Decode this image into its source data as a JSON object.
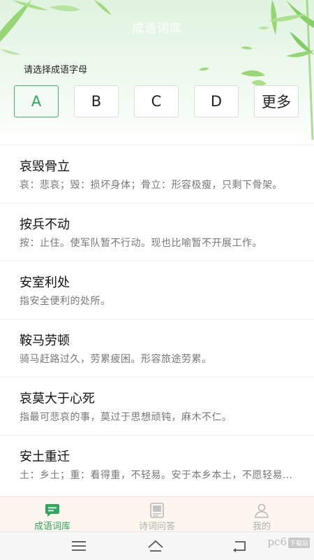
{
  "header": {
    "title": "成语词库",
    "prompt": "请选择成语字母"
  },
  "letters": [
    {
      "label": "A",
      "active": true
    },
    {
      "label": "B",
      "active": false
    },
    {
      "label": "C",
      "active": false
    },
    {
      "label": "D",
      "active": false
    },
    {
      "label": "更多",
      "active": false
    }
  ],
  "idioms": [
    {
      "name": "哀毁骨立",
      "desc": "哀：悲哀；毁：损坏身体；骨立：形容极瘦，只剩下骨架。"
    },
    {
      "name": "按兵不动",
      "desc": "按：止住。使军队暂不行动。现也比喻暂不开展工作。"
    },
    {
      "name": "安室利处",
      "desc": "指安全便利的处所。"
    },
    {
      "name": "鞍马劳顿",
      "desc": "骑马赶路过久，劳累疲困。形容旅途劳累。"
    },
    {
      "name": "哀莫大于心死",
      "desc": "指最可悲哀的事，莫过于思想顽钝，麻木不仁。"
    },
    {
      "name": "安土重迁",
      "desc": "土：乡土；重：看得重，不轻易。安于本乡本土，不愿轻易迁移。"
    }
  ],
  "tabs": [
    {
      "label": "成语词库",
      "icon": "chat-bubble-icon",
      "active": true
    },
    {
      "label": "诗词问答",
      "icon": "book-icon",
      "active": false
    },
    {
      "label": "我的",
      "icon": "user-icon",
      "active": false
    }
  ],
  "system_nav": {
    "menu_icon": "menu-icon",
    "home_icon": "home-icon",
    "back_icon": "back-icon"
  },
  "watermark": {
    "text": "pc6",
    "badge": "下载站"
  },
  "colors": {
    "accent": "#2ea85a",
    "tabbar_bg": "#fdf6ef",
    "header_bg": "#e4f5e4"
  }
}
